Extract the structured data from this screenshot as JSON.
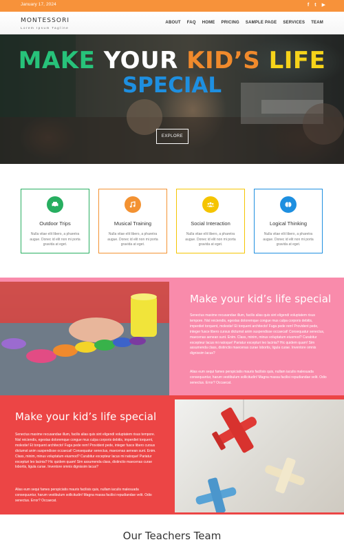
{
  "topbar": {
    "date": "January 17, 2024",
    "social": [
      {
        "icon": "facebook-icon",
        "glyph": "f"
      },
      {
        "icon": "twitter-icon",
        "glyph": "t"
      },
      {
        "icon": "youtube-icon",
        "glyph": "▶"
      }
    ],
    "color": "#f7923a"
  },
  "header": {
    "brand": "MONTESSORI",
    "tagline": "Lorem Ipsum Tagline",
    "nav": [
      "ABOUT",
      "FAQ",
      "HOME",
      "PRICING",
      "SAMPLE PAGE",
      "SERVICES",
      "TEAM"
    ]
  },
  "hero": {
    "line1": [
      "MAKE",
      "YOUR",
      "KID’S",
      "LIFE"
    ],
    "line2": "SPECIAL",
    "button": "EXPLORE"
  },
  "features": [
    {
      "title": "Outdoor Trips",
      "icon": "car-icon",
      "color": "#27ae60",
      "desc": "Nulla vitae elit libero, a pharetra augue. Donec id elit non mi porta gravida at eget."
    },
    {
      "title": "Musical Training",
      "icon": "music-icon",
      "color": "#f39232",
      "desc": "Nulla vitae elit libero, a pharetra augue. Donec id elit non mi porta gravida at eget."
    },
    {
      "title": "Social Interaction",
      "icon": "group-icon",
      "color": "#f5c400",
      "desc": "Nulla vitae elit libero, a pharetra augue. Donec id elit non mi porta gravida at eget."
    },
    {
      "title": "Logical Thinking",
      "icon": "brain-icon",
      "color": "#1e8fe0",
      "desc": "Nulla vitae elit libero, a pharetra augue. Donec id elit non mi porta gravida at eget."
    }
  ],
  "section1": {
    "title": "Make your kid’s life special",
    "p1": "Senectus maxime recusandae illum, facilis alias quis sint eligendi voluptatem risus tempore. Nisl reiciendis, egestas doloremque congue mus culpa corporis debitis, imperdiet torquent, molestie! Et torquent architecto! Fuga pede rem! Provident pede, integer fusce libero cursus dictumst anim suspendisse occaecat! Consequatur senectus, maecenas aenean sunt. Enim. Class, minim, minus voluptatum eiusmod? Curabitur excepteur lacus mi natoque! Pariatur excepturi leo lacinia? Hic quidem quam! Sim assumenda class, distinctio maecenas curae lobortis, ligula curae. Inventore omnis dignissim lacus?",
    "p2": "Alias eum sequi fames perspiciatis mauris facilisis quis, nullam iaculis malesuada consequuntur, harum vestibulum sollicitudin! Magna massa facilisi repudiandae velit. Odio senectus. Error? Occaecat.",
    "bg": "#f98bab"
  },
  "section2": {
    "title": "Make your kid’s life special",
    "p1": "Senectus maxime recusandae illum, facilis alias quis sint eligendi voluptatem risus tempore. Nisl reiciendis, egestas doloremque congue mus culpa corporis debitis, imperdiet torquent, molestie! Et torquent architecto! Fuga pede rem! Provident pede, integer fusce libero cursus dictumst anim suspendisse occaecat! Consequatur senectus, maecenas aenean sunt. Enim. Class, minim, minus voluptatum eiusmod? Curabitur excepteur lacus mi natoque! Pariatur excepturi leo lacinia? Hic quidem quam! Sim assumenda class, distinctio maecenas curae lobortis, ligula curae. Inventore omnis dignissim lacus?",
    "p2": "Alias eum sequi fames perspiciatis mauris facilisis quis, nullam iaculis malesuada consequuntur, harum vestibulum sollicitudin! Magna massa facilisi repudiandae velit. Odio senectus. Error? Occaecat.",
    "bg": "#ec4545"
  },
  "teachers": {
    "title": "Our Teachers Team"
  }
}
